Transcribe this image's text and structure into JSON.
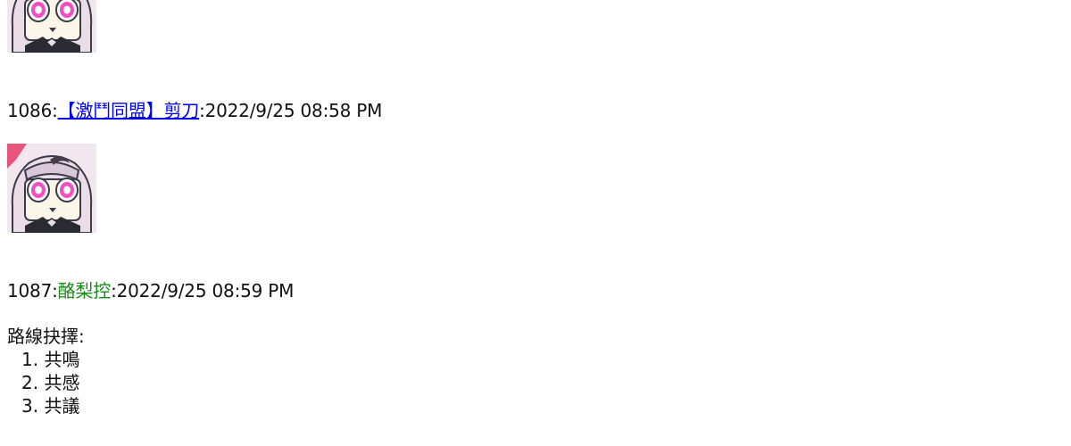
{
  "posts": [
    {
      "number": "1086",
      "author": "【激鬥同盟】剪刀",
      "timestamp": "2022/9/25 08:58 PM"
    },
    {
      "number": "1087",
      "author": "酪梨控",
      "timestamp": "2022/9/25 08:59 PM",
      "body_heading": "路線抉擇:",
      "options": [
        {
          "index": "1.",
          "label": "共鳴"
        },
        {
          "index": "2.",
          "label": "共感"
        },
        {
          "index": "3.",
          "label": "共議"
        }
      ]
    }
  ],
  "separator": ":",
  "colors": {
    "link": "#0000ee",
    "author_plain": "#1a8a1a",
    "text": "#111111"
  },
  "icons": {
    "avatar": "anime-girl-avatar-icon"
  }
}
